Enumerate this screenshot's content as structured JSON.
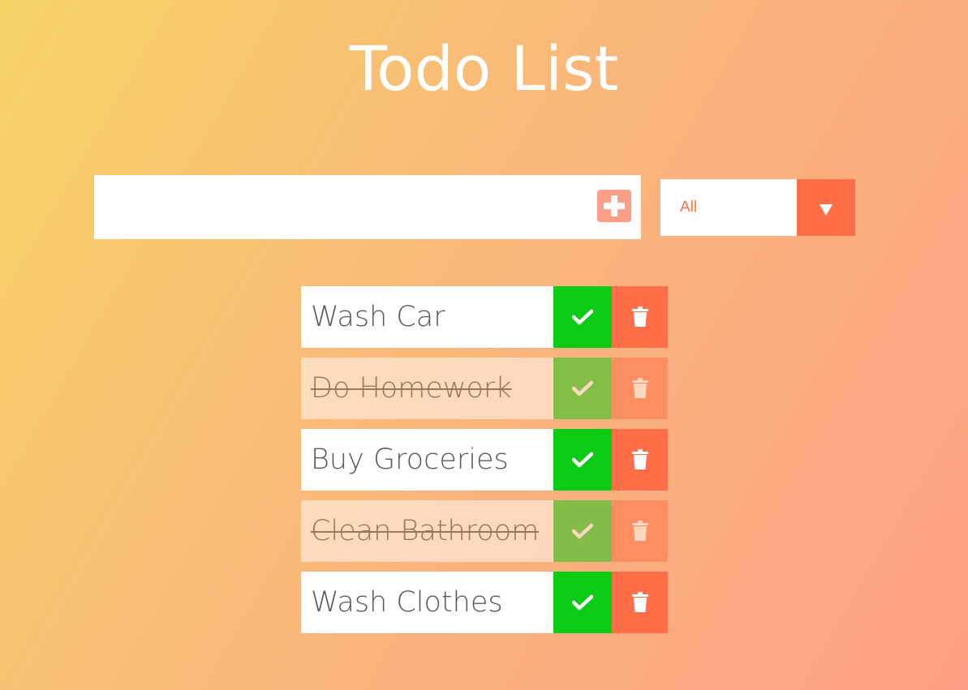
{
  "header": {
    "title": "Todo List"
  },
  "form": {
    "input_value": "",
    "input_placeholder": "",
    "add_icon": "plus-square-icon",
    "filter": {
      "selected": "All",
      "options": [
        "All"
      ],
      "arrow_icon": "caret-down-icon"
    }
  },
  "todos": [
    {
      "text": "Wash Car",
      "completed": false
    },
    {
      "text": "Do Homework",
      "completed": true
    },
    {
      "text": "Buy Groceries",
      "completed": false
    },
    {
      "text": "Clean Bathroom",
      "completed": true
    },
    {
      "text": "Wash Clothes",
      "completed": false
    }
  ],
  "icons": {
    "complete": "check-icon",
    "delete": "trash-icon"
  },
  "colors": {
    "gradient_start": "#f6d365",
    "gradient_end": "#fda085",
    "accent": "#ff6f47",
    "complete_green": "#0ccb15",
    "add_button": "#fd9e86",
    "title_text": "#ffffff"
  }
}
